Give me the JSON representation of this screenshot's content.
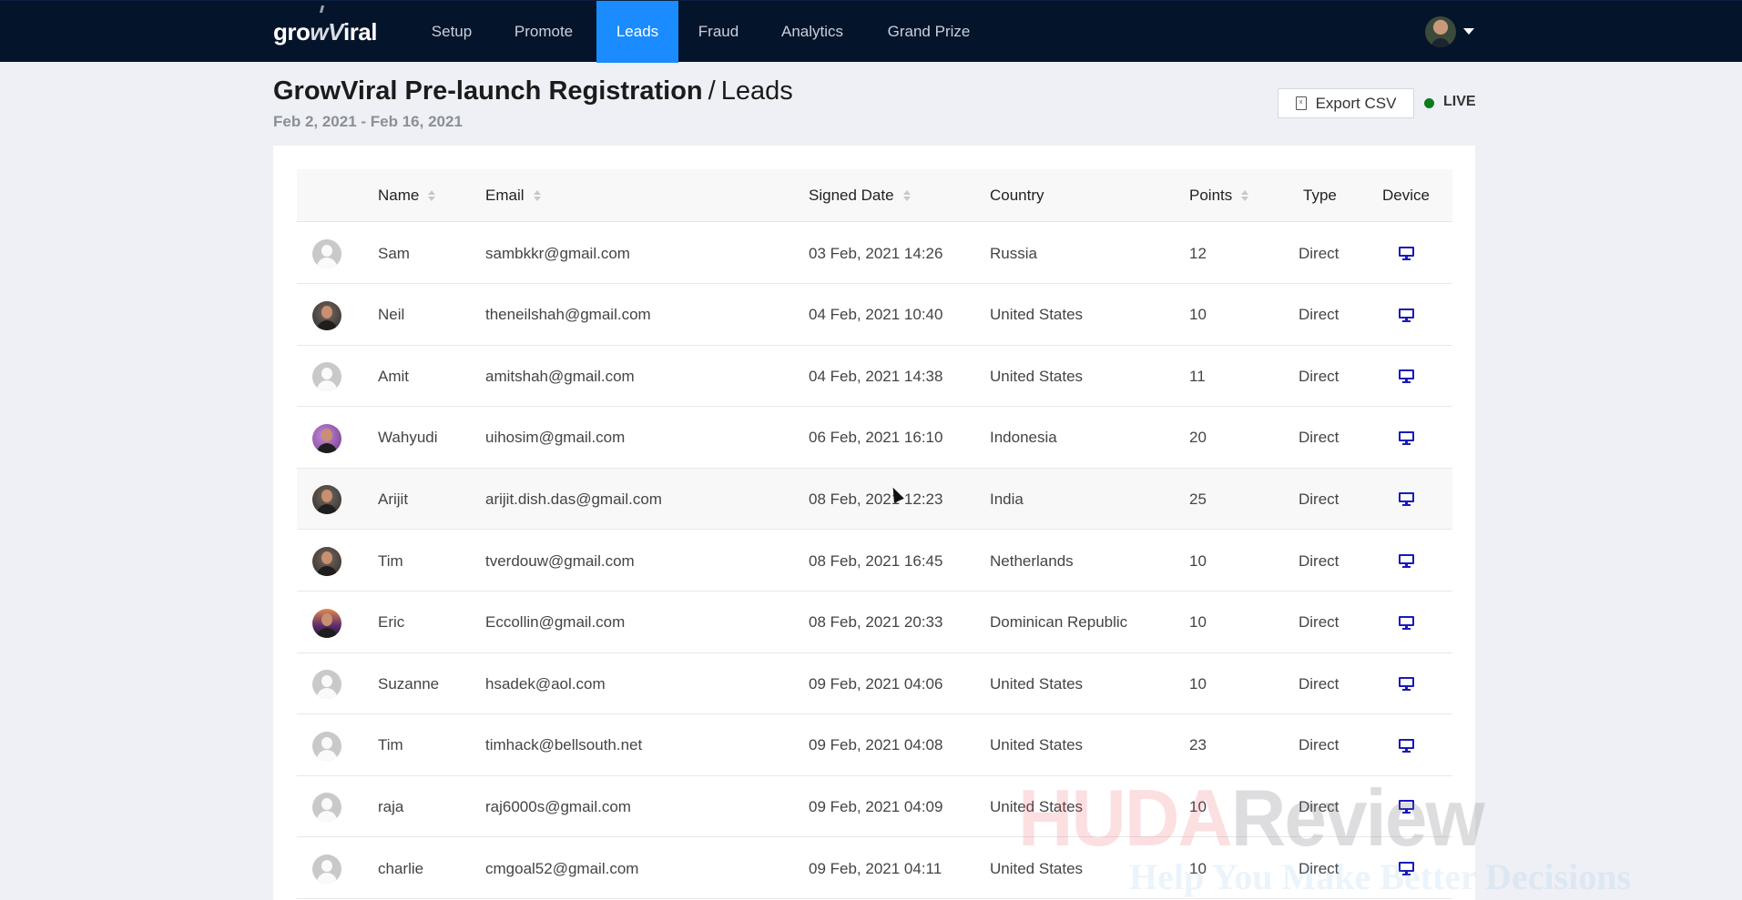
{
  "nav": {
    "logo": {
      "pre": "gro",
      "mark": "wV",
      "post": "iral"
    },
    "items": [
      {
        "label": "Setup",
        "active": false
      },
      {
        "label": "Promote",
        "active": false
      },
      {
        "label": "Leads",
        "active": true
      },
      {
        "label": "Fraud",
        "active": false
      },
      {
        "label": "Analytics",
        "active": false
      },
      {
        "label": "Grand Prize",
        "active": false
      }
    ],
    "accent_color": "#1a8cff",
    "bg_color": "#04142a"
  },
  "header": {
    "campaign": "GrowViral Pre-launch Registration",
    "separator": "/",
    "section": "Leads",
    "date_range": "Feb 2, 2021 - Feb 16, 2021",
    "export_label": "Export CSV",
    "export_icon": "file-excel-icon",
    "status_label": "LIVE",
    "status_color": "#0a7d1a"
  },
  "table": {
    "columns": [
      {
        "label": "",
        "sortable": false
      },
      {
        "label": "Name",
        "sortable": true
      },
      {
        "label": "Email",
        "sortable": true
      },
      {
        "label": "Signed Date",
        "sortable": true
      },
      {
        "label": "Country",
        "sortable": false
      },
      {
        "label": "Points",
        "sortable": true
      },
      {
        "label": "Type",
        "sortable": false
      },
      {
        "label": "Device",
        "sortable": false
      }
    ],
    "device_icon": "desktop-icon",
    "device_color": "#1a1aba",
    "rows": [
      {
        "avatar": "default",
        "name": "Sam",
        "email": "sambkkr@gmail.com",
        "date": "03 Feb, 2021 14:26",
        "country": "Russia",
        "points": "12",
        "type": "Direct",
        "device": "desktop"
      },
      {
        "avatar": "photo",
        "name": "Neil",
        "email": "theneilshah@gmail.com",
        "date": "04 Feb, 2021 10:40",
        "country": "United States",
        "points": "10",
        "type": "Direct",
        "device": "desktop"
      },
      {
        "avatar": "default",
        "name": "Amit",
        "email": "amitshah@gmail.com",
        "date": "04 Feb, 2021 14:38",
        "country": "United States",
        "points": "11",
        "type": "Direct",
        "device": "desktop"
      },
      {
        "avatar": "photo-purple",
        "name": "Wahyudi",
        "email": "uihosim@gmail.com",
        "date": "06 Feb, 2021 16:10",
        "country": "Indonesia",
        "points": "20",
        "type": "Direct",
        "device": "desktop"
      },
      {
        "avatar": "photo",
        "name": "Arijit",
        "email": "arijit.dish.das@gmail.com",
        "date": "08 Feb, 2021 12:23",
        "country": "India",
        "points": "25",
        "type": "Direct",
        "device": "desktop"
      },
      {
        "avatar": "photo",
        "name": "Tim",
        "email": "tverdouw@gmail.com",
        "date": "08 Feb, 2021 16:45",
        "country": "Netherlands",
        "points": "10",
        "type": "Direct",
        "device": "desktop"
      },
      {
        "avatar": "photo-sunset",
        "name": "Eric",
        "email": "Eccollin@gmail.com",
        "date": "08 Feb, 2021 20:33",
        "country": "Dominican Republic",
        "points": "10",
        "type": "Direct",
        "device": "desktop"
      },
      {
        "avatar": "default",
        "name": "Suzanne",
        "email": "hsadek@aol.com",
        "date": "09 Feb, 2021 04:06",
        "country": "United States",
        "points": "10",
        "type": "Direct",
        "device": "desktop"
      },
      {
        "avatar": "default",
        "name": "Tim",
        "email": "timhack@bellsouth.net",
        "date": "09 Feb, 2021 04:08",
        "country": "United States",
        "points": "23",
        "type": "Direct",
        "device": "desktop"
      },
      {
        "avatar": "default",
        "name": "raja",
        "email": "raj6000s@gmail.com",
        "date": "09 Feb, 2021 04:09",
        "country": "United States",
        "points": "10",
        "type": "Direct",
        "device": "desktop"
      },
      {
        "avatar": "default",
        "name": "charlie",
        "email": "cmgoal52@gmail.com",
        "date": "09 Feb, 2021 04:11",
        "country": "United States",
        "points": "10",
        "type": "Direct",
        "device": "desktop"
      }
    ]
  },
  "watermark": {
    "brand_a": "HUDA",
    "brand_b": "Review",
    "tagline": "Help You Make Better Decisions"
  }
}
